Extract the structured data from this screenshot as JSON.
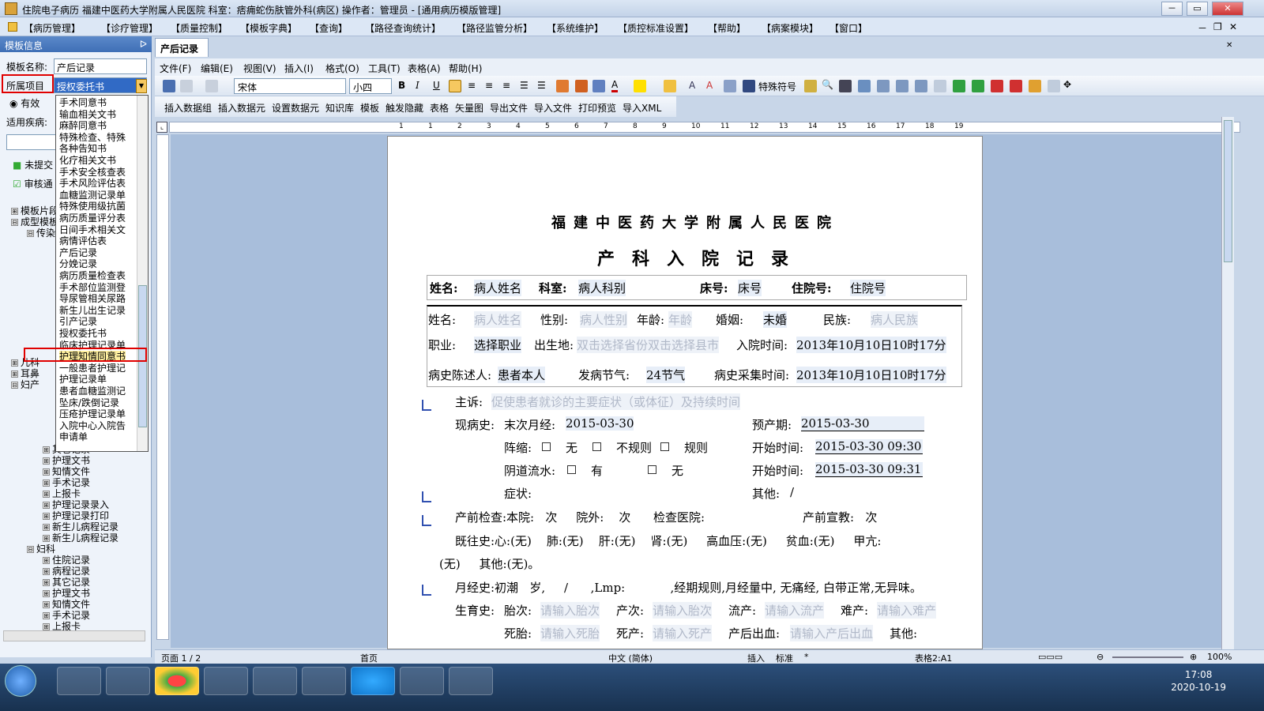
{
  "window": {
    "title": "住院电子病历  福建中医药大学附属人民医院  科室：痞痈蛇伤肤管外科(病区) 操作者：管理员 - [通用病历模版管理]",
    "min": "－",
    "max": "▭",
    "close": "✕"
  },
  "main_menu": [
    "【病历管理】",
    "【诊疗管理】",
    "【质量控制】",
    "【模板字典】",
    "【查询】",
    "【路径查询统计】",
    "【路径监管分析】",
    "【系统维护】",
    "【质控标准设置】",
    "【帮助】",
    "【病案模块】",
    "【窗口】"
  ],
  "left_panel": {
    "header": "模板信息",
    "pin": "ᐅ",
    "template_name_label": "模板名称:",
    "template_name_value": "产后记录",
    "project_label": "所属项目",
    "project_value": "授权委托书",
    "valid_label": "有效",
    "disease_label": "适用疾病:",
    "btn_unsubmitted": "未提交",
    "btn_reviewing": "审核通",
    "tree": [
      {
        "label": "模板片段",
        "level": 0,
        "sign": "⊞"
      },
      {
        "label": "成型模板",
        "level": 0,
        "sign": "⊟"
      },
      {
        "label": "传染",
        "level": 1,
        "sign": "⊟"
      },
      {
        "label": "儿科",
        "level": 0,
        "sign": "⊞"
      },
      {
        "label": "耳鼻",
        "level": 0,
        "sign": "⊞"
      },
      {
        "label": "妇产",
        "level": 0,
        "sign": "⊟"
      },
      {
        "label": "其它记录",
        "level": 2,
        "sign": "⊞"
      },
      {
        "label": "护理文书",
        "level": 2,
        "sign": "⊞"
      },
      {
        "label": "知情文件",
        "level": 2,
        "sign": "⊞"
      },
      {
        "label": "手术记录",
        "level": 2,
        "sign": "⊞"
      },
      {
        "label": "上报卡",
        "level": 2,
        "sign": "⊞"
      },
      {
        "label": "护理记录录入",
        "level": 2,
        "sign": "⊞"
      },
      {
        "label": "护理记录打印",
        "level": 2,
        "sign": "⊞"
      },
      {
        "label": "新生儿病程记录",
        "level": 2,
        "sign": "⊞"
      },
      {
        "label": "新生儿病程记录",
        "level": 2,
        "sign": "⊞"
      },
      {
        "label": "妇科",
        "level": 1,
        "sign": "⊟"
      },
      {
        "label": "住院记录",
        "level": 2,
        "sign": "⊞"
      },
      {
        "label": "病程记录",
        "level": 2,
        "sign": "⊞"
      },
      {
        "label": "其它记录",
        "level": 2,
        "sign": "⊞"
      },
      {
        "label": "护理文书",
        "level": 2,
        "sign": "⊞"
      },
      {
        "label": "知情文件",
        "level": 2,
        "sign": "⊞"
      },
      {
        "label": "手术记录",
        "level": 2,
        "sign": "⊞"
      },
      {
        "label": "上报卡",
        "level": 2,
        "sign": "⊞"
      }
    ]
  },
  "dropdown_items": [
    "手术同意书",
    "输血相关文书",
    "麻醉同意书",
    "特殊检查、特殊",
    "各种告知书",
    "化疗相关文书",
    "手术安全核查表",
    "手术风险评估表",
    "血糖监测记录单",
    "特殊使用级抗菌",
    "病历质量评分表",
    "日间手术相关文",
    "病情评估表",
    "产后记录",
    "分娩记录",
    "病历质量检查表",
    "手术部位监测登",
    "导尿管相关尿路",
    "新生儿出生记录",
    "引产记录",
    "授权委托书",
    "临床护理记录单",
    "护理知情同意书",
    "一般患者护理记",
    "护理记录单",
    "患者血糖监测记",
    "坠床/跌倒记录",
    "压疮护理记录单",
    "入院中心入院告",
    "申请单"
  ],
  "doc_tab": "产后记录",
  "editor_menu": [
    "文件(F)",
    "编辑(E)",
    "视图(V)",
    "插入(I)",
    "格式(O)",
    "工具(T)",
    "表格(A)",
    "帮助(H)"
  ],
  "toolbar1": {
    "font": "宋体",
    "size": "小四",
    "special_chars": "特殊符号"
  },
  "toolbar2": [
    "插入数据组",
    "插入数据元",
    "设置数据元",
    "知识库",
    "模板",
    "触发隐藏",
    "表格",
    "矢量图",
    "导出文件",
    "导入文件",
    "打印预览",
    "导入XML"
  ],
  "ruler_marks": [
    "1",
    "1",
    "2",
    "3",
    "4",
    "5",
    "6",
    "7",
    "8",
    "9",
    "10",
    "11",
    "12",
    "13",
    "14",
    "15",
    "16",
    "17",
    "18",
    "19"
  ],
  "document": {
    "hospital": "福建中医药大学附属人民医院",
    "title": "产科入院记录",
    "header_row": {
      "name_label": "姓名:",
      "name_val": "病人姓名",
      "dept_label": "科室:",
      "dept_val": "病人科别",
      "bed_label": "床号:",
      "bed_val": "床号",
      "inpatient_label": "住院号:",
      "inpatient_val": "住院号"
    },
    "row1": {
      "name_label": "姓名:",
      "name_ph": "病人姓名",
      "sex_label": "性别:",
      "sex_ph": "病人性别",
      "age_label": "年龄:",
      "age_ph": "年龄",
      "marry_label": "婚姻:",
      "marry_val": "未婚",
      "nation_label": "民族:",
      "nation_ph": "病人民族"
    },
    "row2": {
      "job_label": "职业:",
      "job_val": "选择职业",
      "birth_label": "出生地:",
      "birth_ph": "双击选择省份双击选择县市",
      "admit_label": "入院时间:",
      "admit_val": "2013年10月10日10时17分"
    },
    "row3": {
      "narrator_label": "病史陈述人:",
      "narrator_val": "患者本人",
      "onset_label": "发病节气:",
      "onset_val": "24节气",
      "collect_label": "病史采集时间:",
      "collect_val": "2013年10月10日10时17分"
    },
    "complaint_label": "主诉:",
    "complaint_ph": "促使患者就诊的主要症状（或体征）及持续时间",
    "present_label": "现病史:",
    "lmp_label": "末次月经:",
    "lmp_val": "2015-03-30",
    "edc_label": "预产期:",
    "edc_val": "2015-03-30",
    "contraction_label": "阵缩:",
    "opt_none": "无",
    "opt_irregular": "不规则",
    "opt_regular": "规则",
    "start_label": "开始时间:",
    "start_val1": "2015-03-30 09:30",
    "vaginal_label": "阴道流水:",
    "opt_yes": "有",
    "start_val2": "2015-03-30 09:31",
    "symptom_label": "症状:",
    "other_label": "其他:",
    "other_val": "/",
    "prenatal_line": "产前检查:本院:   次     院外:    次      检查医院:                          产前宣教:   次",
    "history_line1": "既往史:心:(无)    肺:(无)    肝:(无)    肾:(无)     高血压:(无)     贫血:(无)     甲亢:",
    "history_line2": "(无)     其他:(无)。",
    "menses_line": "月经史:初潮   岁,     /      ,Lmp:            ,经期规则,月经量中, 无痛经, 白带正常,无异味。",
    "birth_label": "生育史:",
    "gravida_label": "胎次:",
    "gravida_ph": "请输入胎次",
    "para_label": "产次:",
    "para_ph": "请输入胎次",
    "abortion_label": "流产:",
    "abortion_ph": "请输入流产",
    "dystocia_label": "难产:",
    "dystocia_ph": "请输入难产",
    "stillbirth_label": "死胎:",
    "stillbirth_ph": "请输入死胎",
    "death_label": "死产:",
    "death_ph": "请输入死产",
    "pph_label": "产后出血:",
    "pph_ph": "请输入产后出血",
    "other2_label": "其他:"
  },
  "status": {
    "page": "页面 1 / 2",
    "first": "首页",
    "lang": "中文 (简体)",
    "insert": "插入",
    "std": "标准",
    "star": "*",
    "table": "表格2:A1",
    "zoom": "100%"
  },
  "taskbar": {
    "time": "17:08",
    "date": "2020-10-19"
  },
  "colors": {
    "accent": "#3f6fb6",
    "highlight": "#e00000",
    "selected": "#316ac5"
  }
}
